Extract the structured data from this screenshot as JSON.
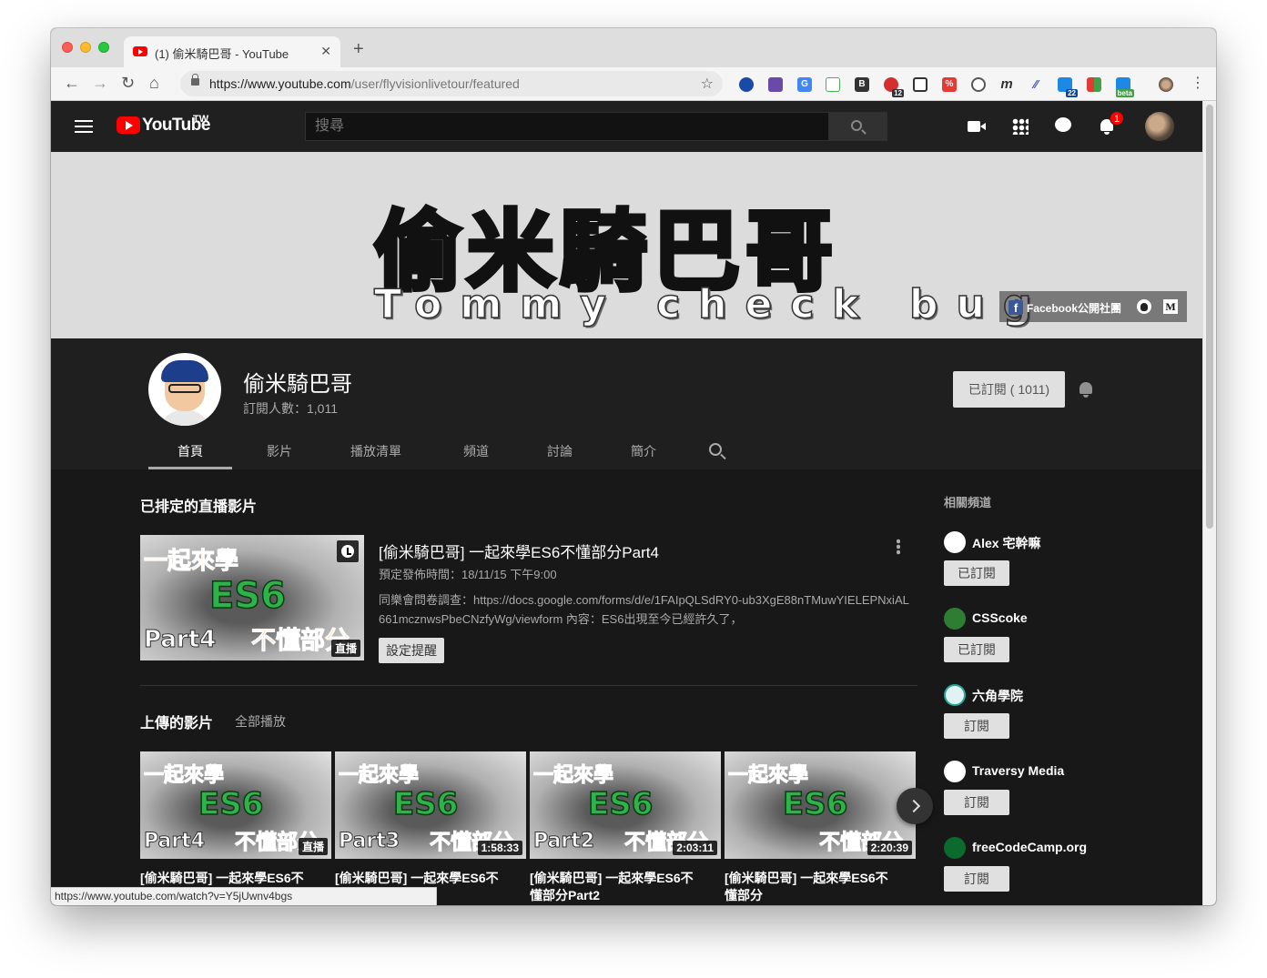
{
  "browser": {
    "tab_title": "(1) 偷米騎巴哥 - YouTube",
    "url_host": "https://www.youtube.com",
    "url_path": "/user/flyvisionlivetour/featured",
    "extension_badges": {
      "ext12": "12",
      "ext22": "22",
      "beta": "beta"
    },
    "status_url": "https://www.youtube.com/watch?v=Y5jUwnv4bgs"
  },
  "youtube": {
    "wordmark": "YouTube",
    "country": "TW",
    "search_placeholder": "搜尋",
    "notification_count": "1"
  },
  "banner": {
    "title": "偷米騎巴哥",
    "subtitle": "Tommy check bug",
    "facebook_label": "Facebook公開社團"
  },
  "channel": {
    "name": "偷米騎巴哥",
    "subscribers": "訂閱人數：1,011",
    "subscribe_label": "已訂閱 ( 1011)",
    "tabs": [
      "首頁",
      "影片",
      "播放清單",
      "頻道",
      "討論",
      "簡介"
    ]
  },
  "scheduled": {
    "section_title": "已排定的直播影片",
    "video_title": "[偷米騎巴哥] 一起來學ES6不懂部分Part4",
    "meta": "預定發佈時間：18/11/15 下午9:00",
    "description": "同樂會問卷調查：https://docs.google.com/forms/d/e/1FAIpQLSdRY0-ub3XgE88nTMuwYIELEPNxiAL661mcznwsPbeCNzfyWg/viewform 內容：ES6出現至今已經許久了，",
    "remind_label": "設定提醒",
    "thumb": {
      "line1": "一起來學",
      "line2": "ES6",
      "part": "Part4",
      "tag": "不懂部分",
      "badge": "直播"
    }
  },
  "uploads": {
    "section_title": "上傳的影片",
    "play_all": "全部播放",
    "videos": [
      {
        "title": "[偷米騎巴哥] 一起來學ES6不",
        "duration": "直播",
        "line1": "一起來學",
        "line2": "ES6",
        "part": "Part4",
        "tag": "不懂部分"
      },
      {
        "title": "[偷米騎巴哥] 一起來學ES6不",
        "duration": "1:58:33",
        "line1": "一起來學",
        "line2": "ES6",
        "part": "Part3",
        "tag": "不懂部分"
      },
      {
        "title": "[偷米騎巴哥] 一起來學ES6不懂部分Part2",
        "duration": "2:03:11",
        "line1": "一起來學",
        "line2": "ES6",
        "part": "Part2",
        "tag": "不懂部分"
      },
      {
        "title": "[偷米騎巴哥] 一起來學ES6不懂部分",
        "duration": "2:20:39",
        "line1": "一起來學",
        "line2": "ES6",
        "part": "",
        "tag": "不懂部分"
      }
    ]
  },
  "related": {
    "title": "相關頻道",
    "channels": [
      {
        "name": "Alex 宅幹嘛",
        "button": "已訂閱",
        "color": "#ffffff"
      },
      {
        "name": "CSScoke",
        "button": "已訂閱",
        "color": "#2e7d32"
      },
      {
        "name": "六角學院",
        "button": "訂閱",
        "color": "#e0f2f1"
      },
      {
        "name": "Traversy Media",
        "button": "訂閱",
        "color": "#ffffff"
      },
      {
        "name": "freeCodeCamp.org",
        "button": "訂閱",
        "color": "#0a6b2c"
      }
    ]
  }
}
